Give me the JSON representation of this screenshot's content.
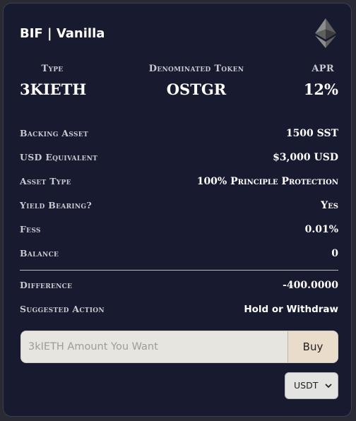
{
  "header": {
    "title": "BIF | Vanilla"
  },
  "icons": {
    "brand": "ethereum-icon",
    "select": "chevron-down-icon"
  },
  "summary": {
    "type_label": "Type",
    "type_value": "3KIETH",
    "token_label": "Denominated Token",
    "token_value": "OSTGR",
    "apr_label": "APR",
    "apr_value": "12%"
  },
  "details": [
    {
      "key": "Backing Asset",
      "value": "1500 SST"
    },
    {
      "key": "USD Equivalent",
      "value": "$3,000 USD"
    },
    {
      "key": "Asset Type",
      "value": "100% Principle Protection"
    },
    {
      "key": "Yield Bearing?",
      "value": "Yes"
    },
    {
      "key": "Fess",
      "value": "0.01%"
    },
    {
      "key": "Balance",
      "value": "0"
    }
  ],
  "summary_rows": [
    {
      "key": "Difference",
      "value": "-400.0000"
    },
    {
      "key": "Suggested Action",
      "value": "Hold or Withdraw"
    }
  ],
  "order": {
    "amount_placeholder": "3kIETH Amount You Want",
    "buy_label": "Buy",
    "currency_selected": "USDT"
  },
  "colors": {
    "card_background": "#181a2f",
    "buy_button": "#eadccb",
    "input_background": "#e6e5df"
  }
}
